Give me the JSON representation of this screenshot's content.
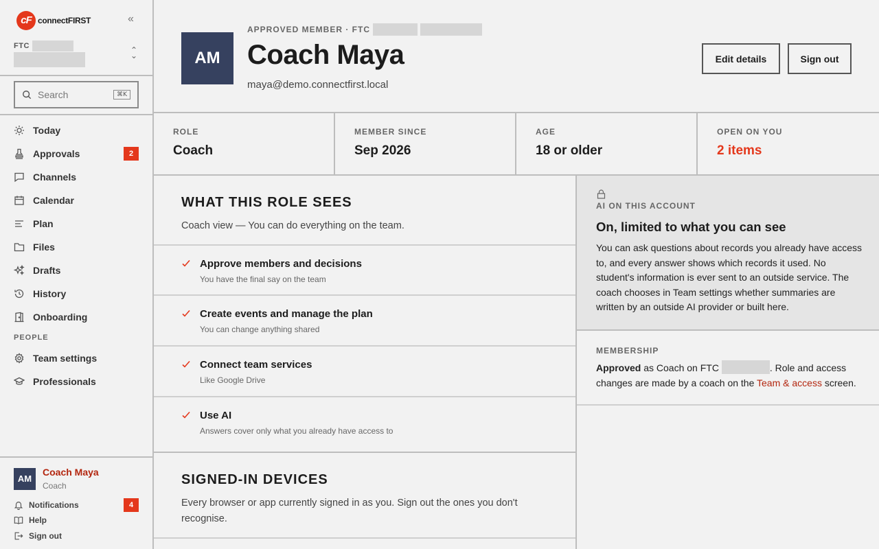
{
  "brand": {
    "mark": "cF",
    "name": "connectFIRST"
  },
  "team": {
    "label": "FTC"
  },
  "search": {
    "placeholder": "Search",
    "shortcut": "⌘K"
  },
  "nav": {
    "items": [
      {
        "label": "Today",
        "icon": "sun-icon"
      },
      {
        "label": "Approvals",
        "icon": "stamp-icon",
        "badge": "2"
      },
      {
        "label": "Channels",
        "icon": "chat-icon"
      },
      {
        "label": "Calendar",
        "icon": "calendar-icon"
      },
      {
        "label": "Plan",
        "icon": "list-icon"
      },
      {
        "label": "Files",
        "icon": "folder-icon"
      },
      {
        "label": "Drafts",
        "icon": "sparkle-icon"
      },
      {
        "label": "History",
        "icon": "history-icon"
      },
      {
        "label": "Onboarding",
        "icon": "door-icon"
      }
    ],
    "section_people": "PEOPLE",
    "people_items": [
      {
        "label": "Team settings",
        "icon": "gear-icon"
      },
      {
        "label": "Professionals",
        "icon": "graduation-cap-icon"
      }
    ]
  },
  "current_user": {
    "initials": "AM",
    "name": "Coach Maya",
    "role": "Coach",
    "notifications_label": "Notifications",
    "notifications_count": "4",
    "help_label": "Help",
    "signout_label": "Sign out"
  },
  "profile": {
    "eyebrow": "APPROVED MEMBER · FTC",
    "initials": "AM",
    "name": "Coach Maya",
    "email": "maya@demo.connectfirst.local",
    "edit_label": "Edit details",
    "signout_label": "Sign out"
  },
  "stats": [
    {
      "label": "ROLE",
      "value": "Coach"
    },
    {
      "label": "MEMBER SINCE",
      "value": "Sep 2026"
    },
    {
      "label": "AGE",
      "value": "18 or older"
    },
    {
      "label": "OPEN ON YOU",
      "value": "2 items"
    }
  ],
  "role_section": {
    "title": "WHAT THIS ROLE SEES",
    "description": "Coach view — You can do everything on the team.",
    "permissions": [
      {
        "title": "Approve members and decisions",
        "desc": "You have the final say on the team"
      },
      {
        "title": "Create events and manage the plan",
        "desc": "You can change anything shared"
      },
      {
        "title": "Connect team services",
        "desc": "Like Google Drive"
      },
      {
        "title": "Use AI",
        "desc": "Answers cover only what you already have access to"
      }
    ]
  },
  "devices_section": {
    "title": "SIGNED-IN DEVICES",
    "description": "Every browser or app currently signed in as you. Sign out the ones you don't recognise."
  },
  "ai_card": {
    "label": "AI ON THIS ACCOUNT",
    "title": "On, limited to what you can see",
    "body": "You can ask questions about records you already have access to, and every answer shows which records it used. No student's information is ever sent to an outside service. The coach chooses in Team settings whether summaries are written by an outside AI provider or built here."
  },
  "membership": {
    "label": "MEMBERSHIP",
    "status": "Approved",
    "text_before": " as Coach on FTC ",
    "text_after": ". Role and access changes are made by a coach on the ",
    "link": "Team & access",
    "text_end": " screen."
  },
  "colors": {
    "accent": "#e4381c",
    "avatar": "#36415f",
    "link": "#b3260f"
  }
}
